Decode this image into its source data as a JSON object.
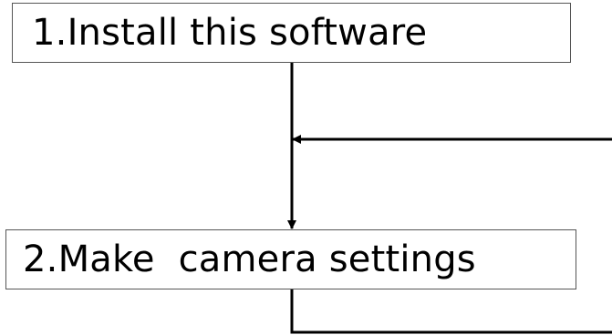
{
  "steps": [
    {
      "id": "step1",
      "label": "1.Install this software"
    },
    {
      "id": "step2",
      "label": "2.Make  camera settings"
    }
  ],
  "colors": {
    "line": "#000000",
    "box_border": "#555555",
    "background": "#ffffff"
  }
}
